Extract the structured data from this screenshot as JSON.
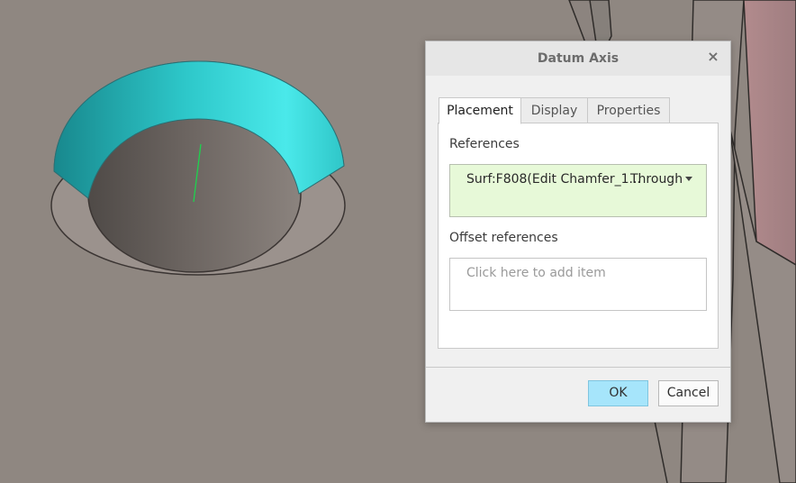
{
  "dialog": {
    "title": "Datum Axis",
    "close_label": "×",
    "tabs": [
      {
        "label": "Placement"
      },
      {
        "label": "Display"
      },
      {
        "label": "Properties"
      }
    ],
    "placement": {
      "references_label": "References",
      "reference_item": "Surf:F808(Edit Chamfer_1...",
      "reference_type": "Through",
      "offset_label": "Offset references",
      "offset_placeholder": "Click here to add item"
    },
    "buttons": {
      "ok": "OK",
      "cancel": "Cancel"
    }
  }
}
